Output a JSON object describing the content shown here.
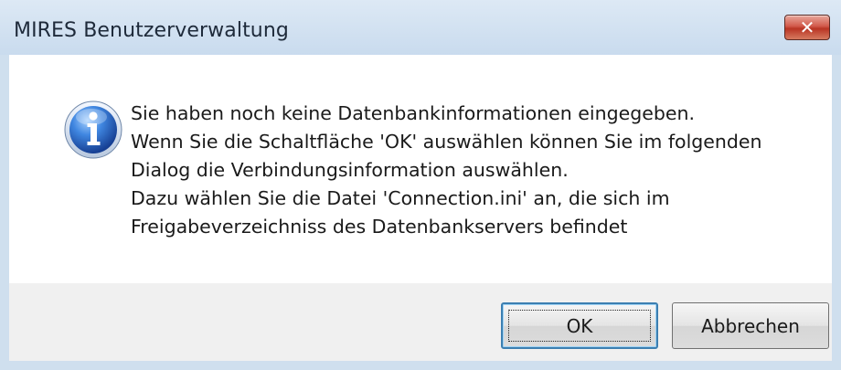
{
  "window": {
    "title": "MIRES Benutzerverwaltung",
    "close_label": "✕"
  },
  "message": {
    "lines": [
      "Sie haben noch keine Datenbankinformationen eingegeben.",
      "Wenn Sie die Schaltfläche 'OK' auswählen können Sie im folgenden",
      "Dialog die Verbindungsinformation auswählen.",
      "Dazu wählen Sie die Datei 'Connection.ini' an, die sich im",
      "Freigabeverzeichniss des Datenbankservers befindet"
    ],
    "icon": "info-icon"
  },
  "buttons": {
    "ok_label": "OK",
    "cancel_label": "Abbrechen"
  },
  "colors": {
    "titlebar": "#cfdfee",
    "close_button": "#c8423a",
    "info_icon": "#2f6fc4"
  }
}
